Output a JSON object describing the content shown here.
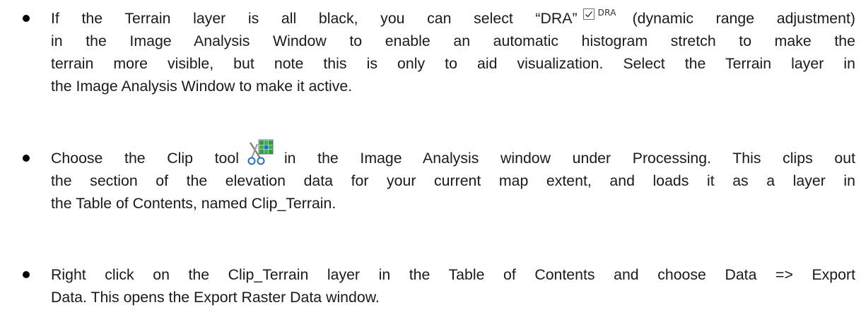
{
  "bullets": [
    {
      "lines": {
        "l1_before": "If the Terrain layer is all black, you can select “DRA”",
        "l1_after": "(dynamic range adjustment)",
        "l2": "in the Image Analysis Window to enable an automatic histogram stretch to make the",
        "l3": "terrain more visible, but note this is only to aid visualization.  Select the Terrain layer in",
        "l4": "the Image Analysis Window to make it active."
      },
      "icon": {
        "name": "dra-checkbox-icon",
        "label": "DRA",
        "checked": true
      }
    },
    {
      "lines": {
        "l1_before": "Choose the Clip tool",
        "l1_after": "in the Image Analysis window under Processing.  This clips out",
        "l2": "the section of the elevation data for your current map extent, and loads it as a layer in",
        "l3": "the Table of Contents, named Clip_Terrain."
      },
      "icon": {
        "name": "clip-tool-icon",
        "colors": [
          "#2e9e3e",
          "#1f6fc5",
          "#8a8a8a"
        ]
      }
    },
    {
      "lines": {
        "l1": "Right click on the Clip_Terrain layer in the Table of Contents and choose Data => Export",
        "l2": "Data.  This opens the Export Raster Data window."
      }
    }
  ]
}
